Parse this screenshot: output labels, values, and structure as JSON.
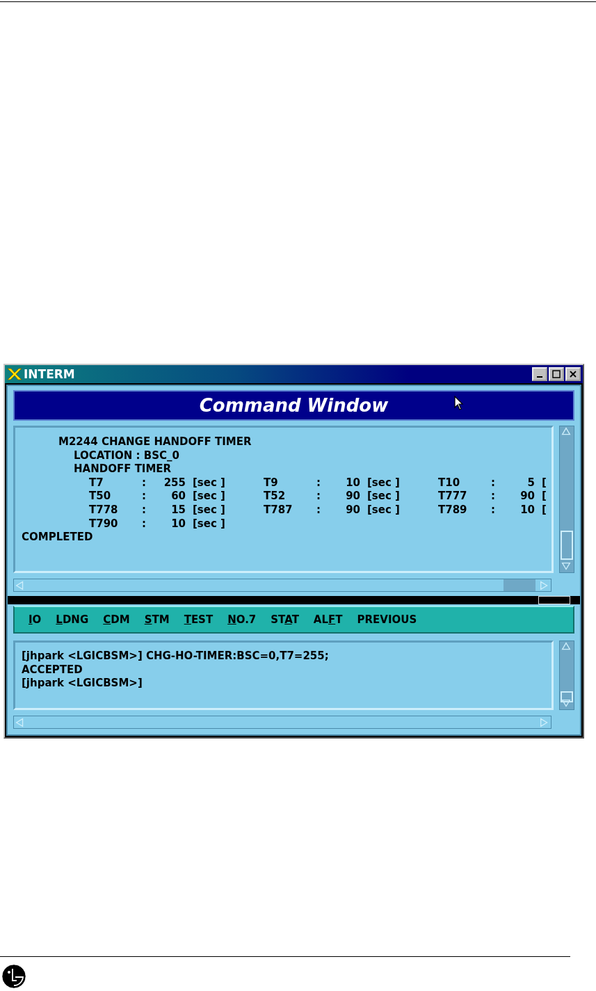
{
  "window": {
    "title": "INTERM",
    "header": "Command Window"
  },
  "output": {
    "lines": [
      "M2244 CHANGE HANDOFF TIMER",
      "LOCATION : BSC_0",
      "HANDOFF TIMER"
    ],
    "timers": [
      {
        "name": "T7",
        "colon": ":",
        "value": "255",
        "unit": "[sec ]"
      },
      {
        "name": "T9",
        "colon": ":",
        "value": "10",
        "unit": "[sec ]"
      },
      {
        "name": "T10",
        "colon": ":",
        "value": "5",
        "unit": "["
      },
      {
        "name": "T50",
        "colon": ":",
        "value": "60",
        "unit": "[sec ]"
      },
      {
        "name": "T52",
        "colon": ":",
        "value": "90",
        "unit": "[sec ]"
      },
      {
        "name": "T777",
        "colon": ":",
        "value": "90",
        "unit": "["
      },
      {
        "name": "T778",
        "colon": ":",
        "value": "15",
        "unit": "[sec ]"
      },
      {
        "name": "T787",
        "colon": ":",
        "value": "90",
        "unit": "[sec ]"
      },
      {
        "name": "T789",
        "colon": ":",
        "value": "10",
        "unit": "["
      },
      {
        "name": "T790",
        "colon": ":",
        "value": "10",
        "unit": "[sec ]"
      }
    ],
    "status": "COMPLETED"
  },
  "menu": [
    {
      "key": "I",
      "post": "O"
    },
    {
      "key": "L",
      "post": "DNG"
    },
    {
      "key": "C",
      "post": "DM"
    },
    {
      "key": "S",
      "post": "TM"
    },
    {
      "key": "T",
      "post": "EST"
    },
    {
      "key": "N",
      "post": "O.7"
    },
    {
      "pre": "ST",
      "key": "A",
      "post": "T"
    },
    {
      "pre": "AL",
      "key": "F",
      "post": "T"
    },
    {
      "pre": "PREVIOUS"
    }
  ],
  "input": {
    "lines": [
      "[jhpark <LGICBSM>] CHG-HO-TIMER:BSC=0,T7=255;",
      "ACCEPTED",
      "[jhpark <LGICBSM>]"
    ]
  }
}
